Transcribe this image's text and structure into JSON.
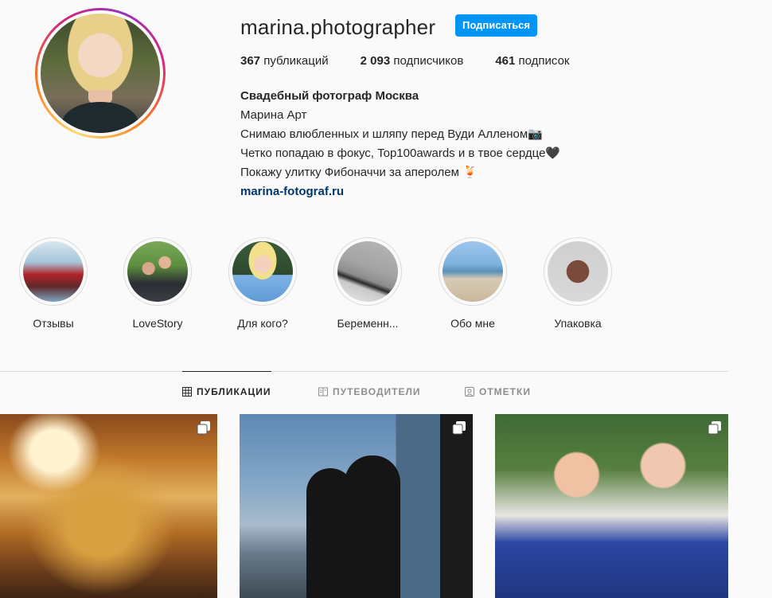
{
  "profile": {
    "username": "marina.photographer",
    "follow_label": "Подписаться",
    "stats": {
      "posts_count": "367",
      "posts_label": "публикаций",
      "followers_count": "2 093",
      "followers_label": "подписчиков",
      "following_count": "461",
      "following_label": "подписок"
    },
    "bio": {
      "name": "Свадебный фотограф Москва",
      "line1": "Марина Арт",
      "line2": "Снимаю влюбленных и шляпу перед Вуди Алленом📷",
      "line3": "Четко попадаю в фокус, Top100awards и в твое сердце🖤",
      "line4": "Покажу улитку Фибоначчи за аперолем 🍹",
      "link": "marina-fotograf.ru"
    }
  },
  "highlights": [
    {
      "label": "Отзывы"
    },
    {
      "label": "LoveStory"
    },
    {
      "label": "Для кого?"
    },
    {
      "label": "Беременн..."
    },
    {
      "label": "Обо мне"
    },
    {
      "label": "Упаковка"
    }
  ],
  "tabs": [
    {
      "label": "ПУБЛИКАЦИИ",
      "icon": "grid-icon",
      "active": true
    },
    {
      "label": "ПУТЕВОДИТЕЛИ",
      "icon": "guide-icon",
      "active": false
    },
    {
      "label": "ОТМЕТКИ",
      "icon": "tagged-icon",
      "active": false
    }
  ],
  "posts": [
    {
      "icon": "carousel-icon"
    },
    {
      "icon": "carousel-icon"
    },
    {
      "icon": "carousel-icon"
    }
  ],
  "colors": {
    "accent": "#0095f6",
    "link": "#00376b",
    "text": "#262626",
    "muted": "#8e8e8e"
  }
}
